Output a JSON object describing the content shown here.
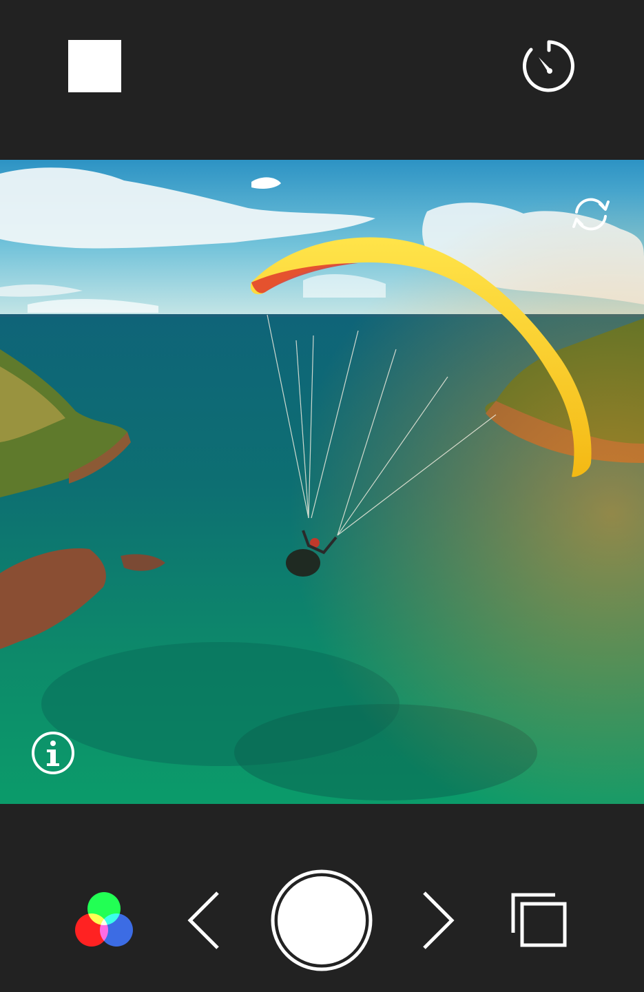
{
  "app": {
    "background_color": "#222222",
    "icon_color": "#ffffff"
  },
  "top_bar": {
    "aspect_ratio_button": {
      "icon": "square-aspect-icon"
    },
    "timer_button": {
      "icon": "timer-icon"
    }
  },
  "viewfinder": {
    "switch_camera_button": {
      "icon": "switch-camera-icon"
    },
    "info_button": {
      "icon": "info-icon"
    }
  },
  "bottom_bar": {
    "filter_button": {
      "icon": "rgb-filter-icon",
      "colors": [
        "#00ff3a",
        "#ff0000",
        "#1e55e0"
      ]
    },
    "previous_filter_button": {
      "icon": "chevron-left-icon"
    },
    "shutter_button": {
      "icon": "shutter-icon"
    },
    "next_filter_button": {
      "icon": "chevron-right-icon"
    },
    "gallery_button": {
      "icon": "gallery-icon"
    }
  }
}
